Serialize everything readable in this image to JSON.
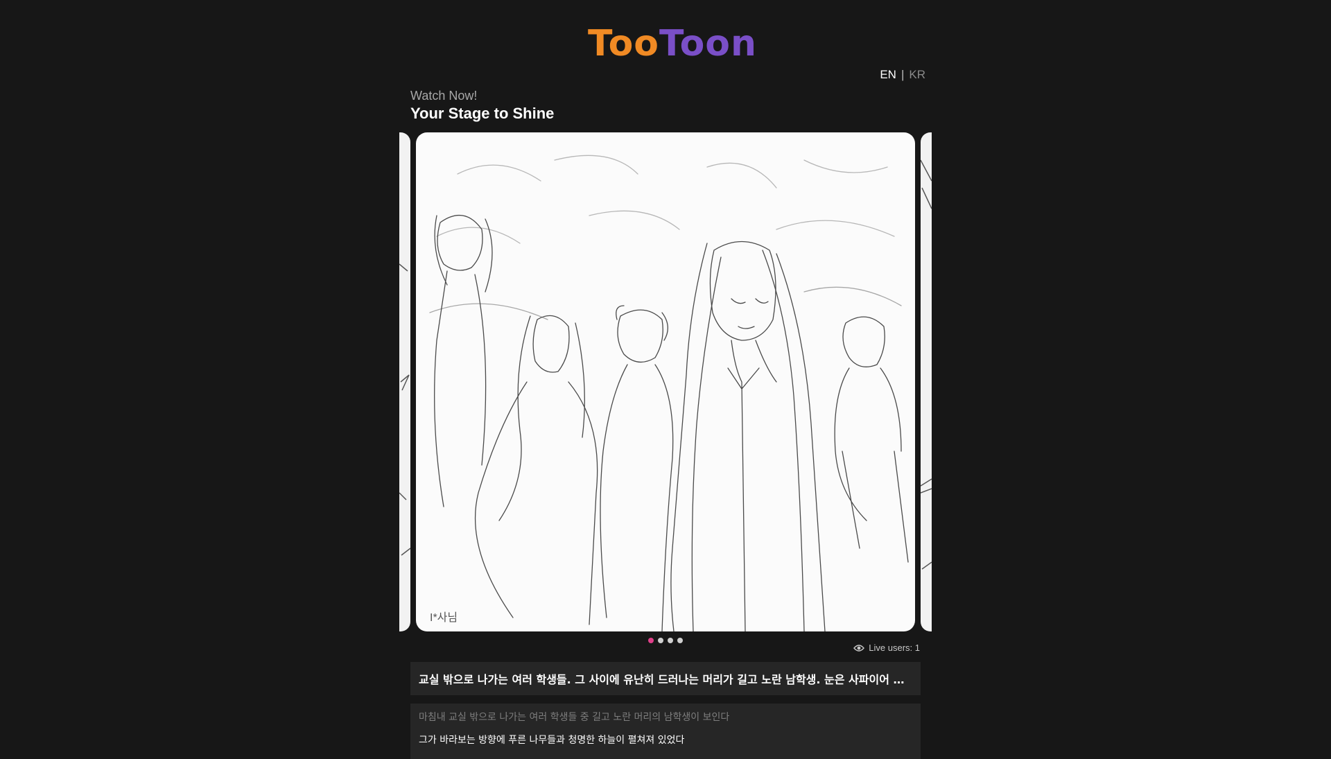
{
  "header": {
    "logo_part1": "Too",
    "logo_part2": "Toon",
    "lang_en": "EN",
    "lang_separator": "|",
    "lang_kr": "KR"
  },
  "section": {
    "subtitle": "Watch Now!",
    "title": "Your Stage to Shine"
  },
  "carousel": {
    "slide_credit": "I*사님",
    "total_slides": 4,
    "active_slide": 1
  },
  "live": {
    "icon": "eye-icon",
    "text": "Live users: 1"
  },
  "summary": {
    "text": "교실 밖으로 나가는 여러 학생들. 그 사이에 유난히 드러나는 머리가 길고 노란 남학생. 눈은 사파이어 처럼 ..."
  },
  "story": {
    "line1": "마침내 교실 밖으로 나가는 여러 학생들 중 길고 노란 머리의 남학생이 보인다",
    "line2": "그가 바라보는 방향에 푸른 나무들과 청명한 하늘이 펼쳐져 있었다"
  },
  "colors": {
    "background": "#171717",
    "logo_orange": "#f08a24",
    "logo_purple": "#7a4fc7",
    "active_dot": "#e0408a",
    "panel": "#262626"
  }
}
